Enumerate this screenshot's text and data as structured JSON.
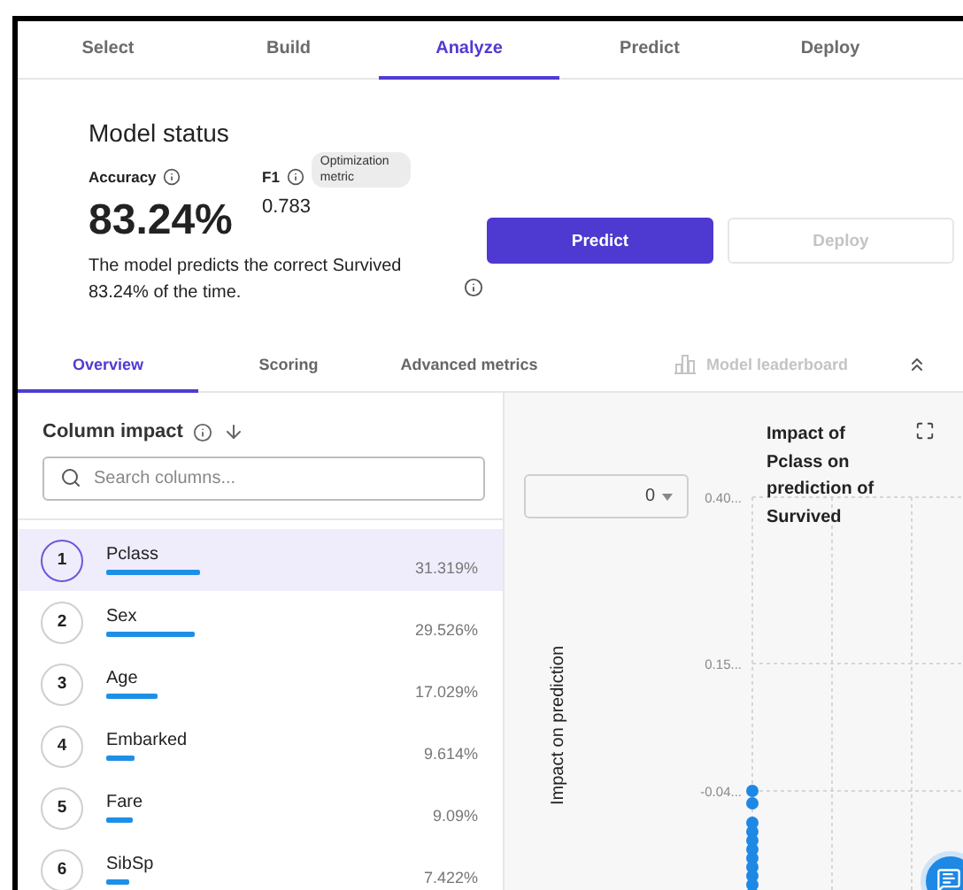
{
  "steps": [
    {
      "label": "Select",
      "selected": false
    },
    {
      "label": "Build",
      "selected": false
    },
    {
      "label": "Analyze",
      "selected": true
    },
    {
      "label": "Predict",
      "selected": false
    },
    {
      "label": "Deploy",
      "selected": false
    }
  ],
  "model_status": {
    "title": "Model status",
    "accuracy": {
      "label": "Accuracy",
      "value": "83.24%"
    },
    "f1": {
      "label": "F1",
      "value": "0.783",
      "badge": "Optimization metric"
    },
    "description": "The model predicts the correct Survived 83.24% of the time.",
    "buttons": [
      {
        "label": "Predict",
        "disabled": false
      },
      {
        "label": "Deploy",
        "disabled": true
      }
    ]
  },
  "subtabs": [
    {
      "label": "Overview",
      "selected": true
    },
    {
      "label": "Scoring",
      "selected": false
    },
    {
      "label": "Advanced metrics",
      "selected": false
    }
  ],
  "leaderboard": {
    "label": "Model leaderboard"
  },
  "column_impact": {
    "title": "Column impact",
    "search": {
      "placeholder": "Search columns..."
    },
    "rows": [
      {
        "rank": "1",
        "name": "Pclass",
        "share": "31.319%",
        "selected": true
      },
      {
        "rank": "2",
        "name": "Sex",
        "share": "29.526%",
        "selected": false
      },
      {
        "rank": "3",
        "name": "Age",
        "share": "17.029%",
        "selected": false
      },
      {
        "rank": "4",
        "name": "Embarked",
        "share": "9.614%",
        "selected": false
      },
      {
        "rank": "5",
        "name": "Fare",
        "share": "9.09%",
        "selected": false
      },
      {
        "rank": "6",
        "name": "SibSp",
        "share": "7.422%",
        "selected": false
      }
    ]
  },
  "chart_panel": {
    "dropdown": {
      "value": "0"
    },
    "chart": {
      "title": "Impact of Pclass on prediction of Survived",
      "ylabel": "Impact on prediction",
      "tick_labels": [
        "0.40...",
        "0.15...",
        "-0.04..."
      ]
    }
  }
}
